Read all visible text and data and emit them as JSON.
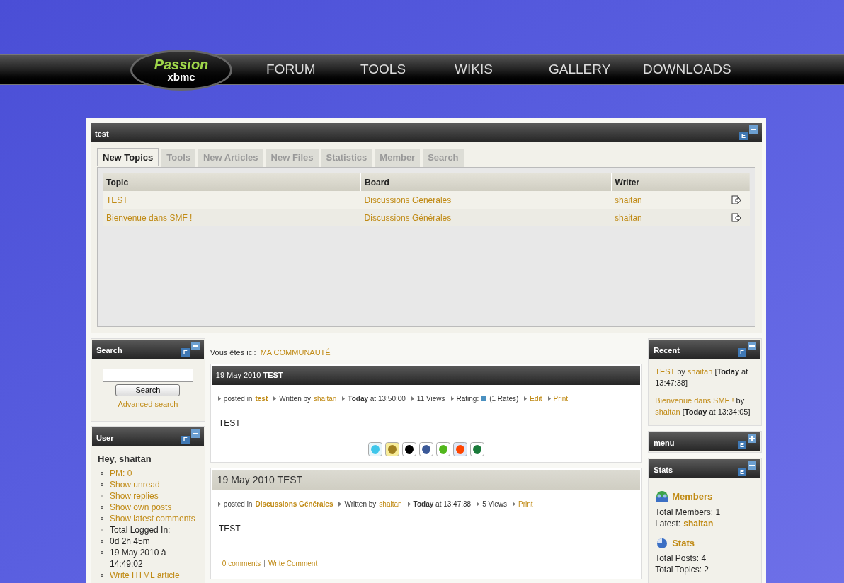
{
  "nav": {
    "logo_top": "Passion",
    "logo_bottom": "xbmc",
    "items": [
      "FORUM",
      "TOOLS",
      "WIKIS",
      "GALLERY",
      "DOWNLOADS"
    ]
  },
  "top_panel": {
    "title": "test",
    "edit_label": "E",
    "collapsed": false,
    "tabs": [
      {
        "label": "New Topics",
        "selected": true
      },
      {
        "label": "Tools",
        "selected": false
      },
      {
        "label": "New Articles",
        "selected": false
      },
      {
        "label": "New Files",
        "selected": false
      },
      {
        "label": "Statistics",
        "selected": false
      },
      {
        "label": "Member",
        "selected": false
      },
      {
        "label": "Search",
        "selected": false
      }
    ],
    "table": {
      "columns": [
        "Topic",
        "Board",
        "Writer"
      ],
      "rows": [
        {
          "topic": "TEST",
          "board": "Discussions Générales",
          "writer": "shaitan"
        },
        {
          "topic": "Bienvenue dans SMF !",
          "board": "Discussions Générales",
          "writer": "shaitan"
        }
      ]
    }
  },
  "left": [
    {
      "kind": "search",
      "title": "Search",
      "edit_label": "E",
      "collapsed": false,
      "button": "Search",
      "link": "Advanced search"
    },
    {
      "kind": "user",
      "title": "User",
      "edit_label": "E",
      "collapsed": false,
      "greeting": "Hey, shaitan",
      "items": [
        {
          "kind": "link",
          "text": "PM: 0"
        },
        {
          "kind": "link",
          "text": "Show unread"
        },
        {
          "kind": "link",
          "text": "Show replies"
        },
        {
          "kind": "link",
          "text": "Show own posts"
        },
        {
          "kind": "link",
          "text": "Show latest comments"
        },
        {
          "kind": "text",
          "text": "Total Logged In:"
        },
        {
          "kind": "text",
          "text": "0d 2h 45m"
        },
        {
          "kind": "text",
          "text": "19 May 2010 à 14:49:02"
        },
        {
          "kind": "link",
          "text": "Write HTML article"
        }
      ]
    }
  ],
  "breadcrumb": {
    "label": "Vous êtes ici:",
    "link": "MA COMMUNAUTÉ"
  },
  "posts": [
    {
      "kind": "dark",
      "title": "19 May 2010 **TEST**",
      "meta": [
        {
          "kind": "labeled",
          "label": "posted in",
          "link": "test",
          "bold": true
        },
        {
          "kind": "labeled",
          "label": "Written by",
          "link": "shaitan",
          "bold": false
        },
        {
          "kind": "text",
          "text": "**Today** at 13:50:00"
        },
        {
          "kind": "text",
          "text": "11 Views"
        },
        {
          "kind": "rating",
          "label": "Rating:",
          "note": "(1 Rates)"
        },
        {
          "kind": "link",
          "link": "Edit"
        },
        {
          "kind": "link",
          "link": "Print"
        }
      ],
      "body": "TEST",
      "share_icons": true
    },
    {
      "kind": "light",
      "title": "19 May 2010 TEST",
      "meta": [
        {
          "kind": "labeled",
          "label": "posted in",
          "link": "Discussions Générales",
          "bold": true
        },
        {
          "kind": "labeled",
          "label": "Written by",
          "link": "shaitan",
          "bold": false
        },
        {
          "kind": "text",
          "text": "**Today** at 13:47:38"
        },
        {
          "kind": "text",
          "text": "5 Views"
        },
        {
          "kind": "link",
          "link": "Print"
        }
      ],
      "body": "TEST",
      "comments": "0 comments",
      "separator": "|",
      "write": "Write Comment"
    }
  ],
  "right": [
    {
      "kind": "recent",
      "title": "Recent",
      "edit_label": "E",
      "collapsed": false,
      "entries": [
        {
          "title": "TEST",
          "by": "by",
          "author": "shaitan",
          "time": "[**Today** at 13:47:38]"
        },
        {
          "title": "Bienvenue dans SMF !",
          "by": "by",
          "author": "shaitan",
          "time": "[**Today** at 13:34:05]"
        }
      ]
    },
    {
      "kind": "menu",
      "title": "menu",
      "edit_label": "E",
      "collapsed": true
    },
    {
      "kind": "stats",
      "title": "Stats",
      "edit_label": "E",
      "collapsed": false,
      "sections": [
        {
          "title": "Members",
          "lines": [
            {
              "label": "Total Members: 1"
            },
            {
              "label": "Latest:",
              "link": "shaitan"
            }
          ]
        },
        {
          "title": "Stats",
          "lines": [
            {
              "label": "Total Posts: 4"
            },
            {
              "label": "Total Topics: 2"
            }
          ]
        }
      ]
    }
  ]
}
